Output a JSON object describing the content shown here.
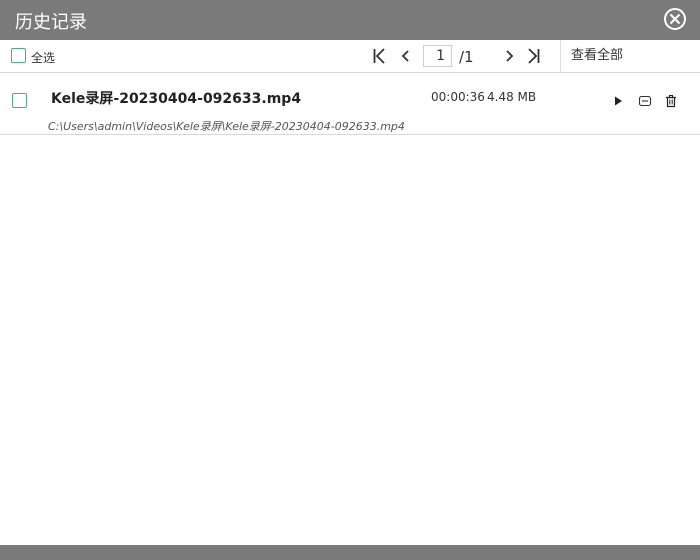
{
  "window": {
    "title": "历史记录"
  },
  "toolbar": {
    "select_all_label": "全选",
    "current_page": "1",
    "total_pages": "/1",
    "view_all_label": "查看全部"
  },
  "records": [
    {
      "file_name": "Kele录屏-20230404-092633.mp4",
      "duration": "00:00:36",
      "size": "4.48 MB",
      "path": "C:\\Users\\admin\\Videos\\Kele录屏\\Kele录屏-20230404-092633.mp4"
    }
  ],
  "colors": {
    "titlebar": "#7a7a7a",
    "checkbox_border": "#4caf7d"
  },
  "icons": [
    "close-icon",
    "first-page-icon",
    "prev-page-icon",
    "next-page-icon",
    "last-page-icon",
    "play-icon",
    "open-folder-icon",
    "trash-icon"
  ]
}
